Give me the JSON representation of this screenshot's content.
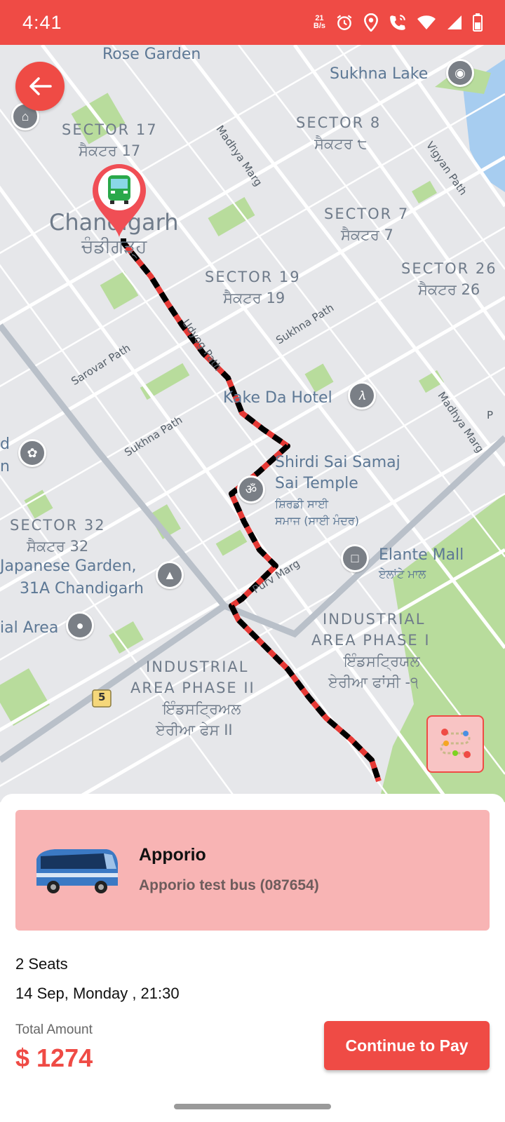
{
  "status_bar": {
    "time": "4:41",
    "net_speed_top": "21",
    "net_speed_bottom": "B/s",
    "icons": [
      "alarm-icon",
      "location-icon",
      "wifi-calling-icon",
      "wifi-icon",
      "signal-icon",
      "battery-icon"
    ]
  },
  "map": {
    "places": [
      "Rose Garden",
      "Sukhna Lake",
      "Kake Da Hotel",
      "Elante Mall",
      "ਏਲਾਂਟੇ ਮਾਲ",
      "Shirdi Sai Samaj",
      "Sai Temple",
      "ਸ਼ਿਰਡੀ ਸਾਈ",
      "ਸਮਾਜ (ਸਾਈ ਮੰਦਰ)",
      "Japanese Garden,",
      "31A Chandigarh",
      "ial Area",
      "d",
      "n"
    ],
    "sectors": [
      {
        "en": "SECTOR 17",
        "pa": "ਸੈਕਟਰ 17"
      },
      {
        "en": "SECTOR 8",
        "pa": "ਸੈਕਟਰ ੮"
      },
      {
        "en": "SECTOR 7",
        "pa": "ਸੈਕਟਰ 7"
      },
      {
        "en": "SECTOR 19",
        "pa": "ਸੈਕਟਰ 19"
      },
      {
        "en": "SECTOR 26",
        "pa": "ਸੈਕਟਰ 26"
      },
      {
        "en": "SECTOR 32",
        "pa": "ਸੈਕਟਰ 32"
      }
    ],
    "city": {
      "en": "Chandigarh",
      "pa": "ਚੰਡੀਗੜ੍ਹ"
    },
    "industrial_1": {
      "line1": "INDUSTRIAL",
      "line2": "AREA PHASE I",
      "pa1": "ਇੰਡਸਟ੍ਰਿਯਲ",
      "pa2": "ਏਰੀਆ ਫਾਂਸੀ -੧"
    },
    "industrial_2": {
      "line1": "INDUSTRIAL",
      "line2": "AREA PHASE II",
      "pa1": "ਇੰਡਸਟ੍ਰਿਅਲ",
      "pa2": "ਏਰੀਆ ਫੇਸ II"
    },
    "roads": [
      "Madhya Marg",
      "Vigyan Path",
      "Udyog Path",
      "Sukhna Path",
      "Sarovar Path",
      "Purv Marg",
      "Madhya Marg",
      "P"
    ],
    "highway_shield": "5"
  },
  "booking": {
    "operator": "Apporio",
    "bus": "Apporio test bus (087654)",
    "seats": "2 Seats",
    "datetime": "14 Sep, Monday , 21:30",
    "total_label": "Total Amount",
    "total_amount": "$ 1274",
    "pay_button": "Continue to Pay"
  },
  "colors": {
    "accent": "#ef4b45",
    "card": "#f8b4b4",
    "map_bg": "#e6e7ea",
    "park": "#b8dc9c",
    "water": "#a7cdf0"
  }
}
